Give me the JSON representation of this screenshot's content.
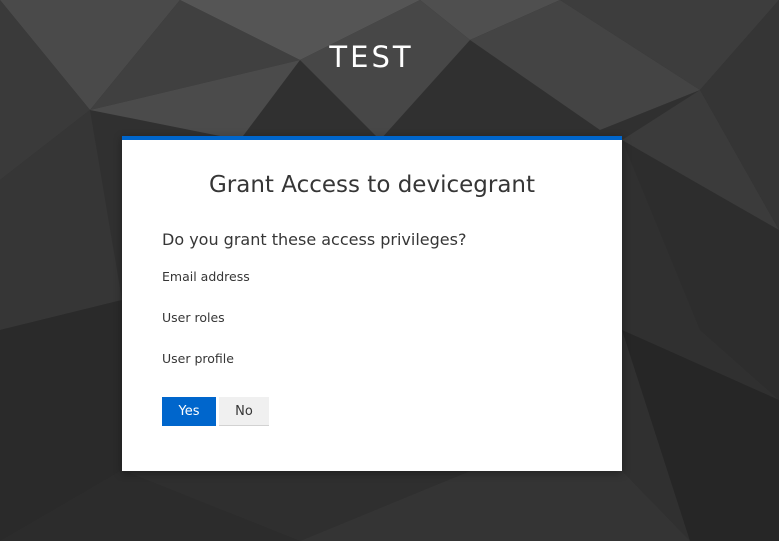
{
  "header": {
    "realm_name": "TEST"
  },
  "consent": {
    "title": "Grant Access to devicegrant",
    "question": "Do you grant these access privileges?",
    "privileges": [
      "Email address",
      "User roles",
      "User profile"
    ],
    "yes_label": "Yes",
    "no_label": "No"
  },
  "colors": {
    "accent": "#0066cc",
    "background": "#2e2e2e",
    "card": "#ffffff",
    "text": "#363636"
  }
}
